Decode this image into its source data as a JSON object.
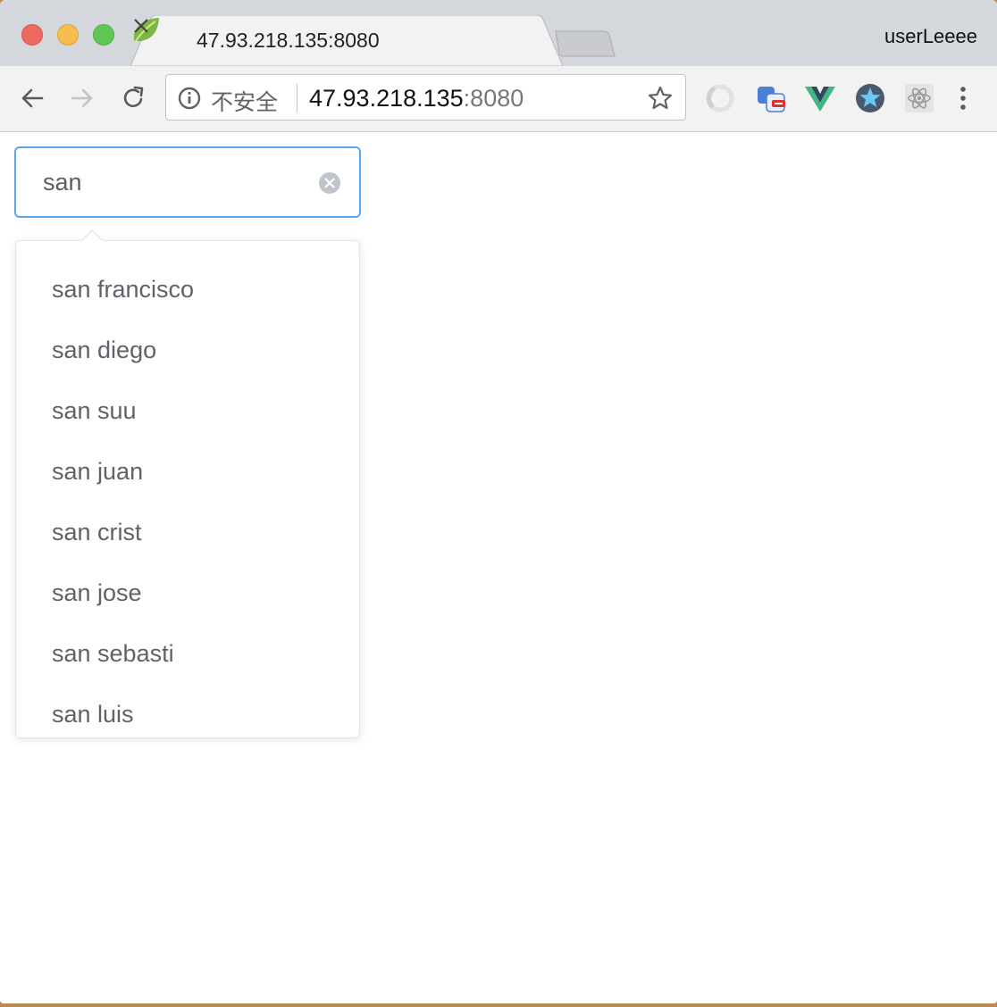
{
  "browser": {
    "tab_title": "47.93.218.135:8080",
    "profile_name": "userLeeee",
    "security_label": "不安全",
    "url_host": "47.93.218.135",
    "url_port": ":8080"
  },
  "icons": {
    "favicon": "spring-leaf-icon",
    "back": "back-arrow-icon",
    "forward": "forward-arrow-icon",
    "reload": "reload-icon",
    "info": "info-icon",
    "bookmark": "star-icon",
    "extensions": [
      "ring-extension-icon",
      "translate-extension-icon",
      "vue-devtools-icon",
      "star-extension-icon",
      "react-devtools-icon"
    ],
    "menu": "menu-dots-icon",
    "clear": "clear-icon"
  },
  "search": {
    "value": "san"
  },
  "suggestions": [
    "san francisco",
    "san diego",
    "san suu",
    "san juan",
    "san crist",
    "san jose",
    "san sebasti",
    "san luis"
  ],
  "colors": {
    "accent": "#5aa6ec",
    "suggestion_text": "#5f6368"
  }
}
